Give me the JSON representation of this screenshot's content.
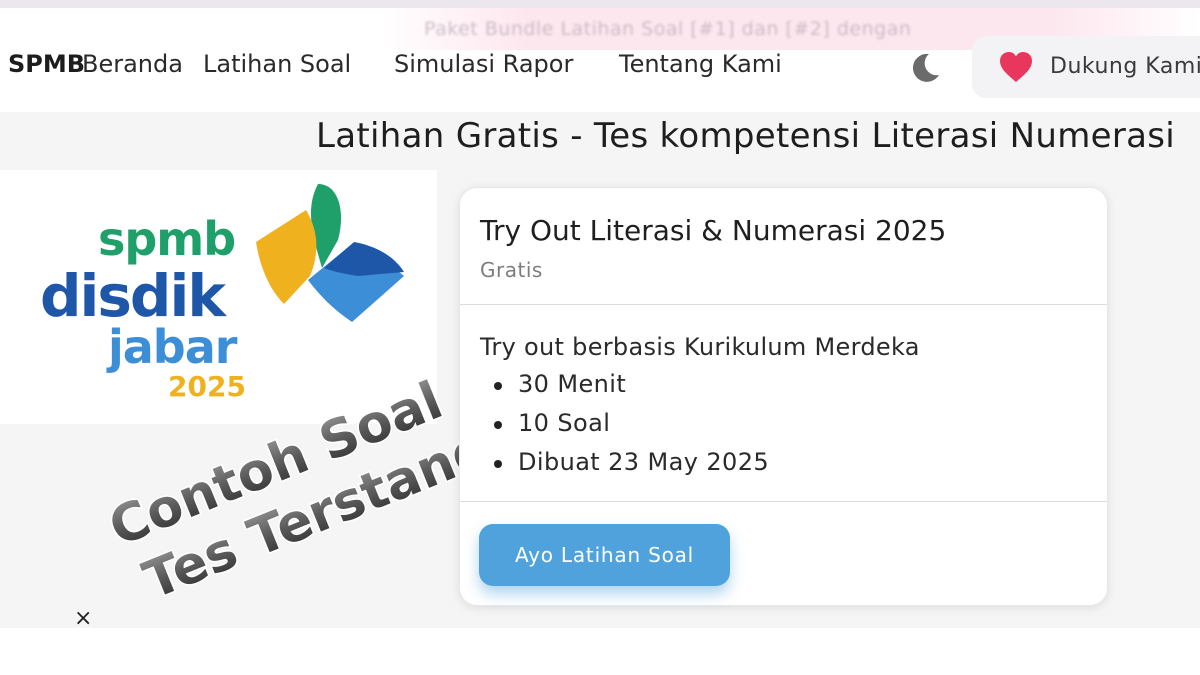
{
  "promo": {
    "text": "Paket Bundle Latihan Soal [#1] dan [#2] dengan"
  },
  "navbar": {
    "brand": "SPMB",
    "links": [
      "Beranda",
      "Latihan Soal",
      "Simulasi Rapor",
      "Tentang Kami"
    ],
    "theme_icon": "moon-icon",
    "support": {
      "icon": "heart-icon",
      "label": "Dukung Kami"
    }
  },
  "page": {
    "title": "Latihan Gratis - Tes kompetensi Literasi Numerasi"
  },
  "logo": {
    "line1": "spmb",
    "line2": "disdik",
    "line3": "jabar",
    "year": "2025"
  },
  "overlay": {
    "line1": "Contoh Soal",
    "line2": "Tes Terstandar"
  },
  "card": {
    "title": "Try Out Literasi & Numerasi 2025",
    "subtitle": "Gratis",
    "description": "Try out berbasis Kurikulum Merdeka",
    "items": [
      "30 Menit",
      "10 Soal",
      "Dibuat 23 May 2025"
    ],
    "button": "Ayo Latihan Soal"
  },
  "close": {
    "glyph": "×"
  },
  "colors": {
    "accent": "#4fa2db",
    "heart": "#e8365d",
    "logo_green": "#1fa06a",
    "logo_blue": "#1f57a8",
    "logo_lightblue": "#3c8fd6",
    "logo_yellow": "#f0b11f"
  }
}
